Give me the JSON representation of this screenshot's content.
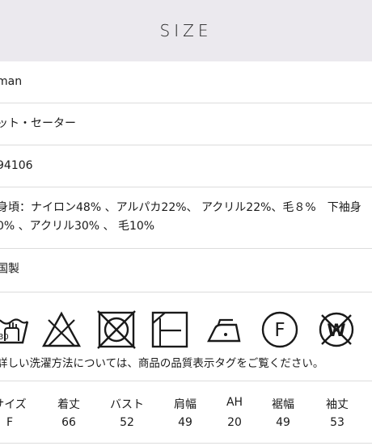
{
  "header": {
    "title": "SIZE"
  },
  "details": {
    "brand": "man",
    "category": "ット・セーター",
    "product_code": "94106",
    "material_line1": "身頃：ナイロン48% 、アルパカ22%、 アクリル22%、毛８%　下袖身",
    "material_line2": "0% 、アクリル30% 、 毛10%",
    "origin": "国製"
  },
  "care": {
    "icons": [
      "hand-wash-30-icon",
      "no-bleach-icon",
      "no-tumble-dry-icon",
      "line-dry-shade-icon",
      "iron-low-icon",
      "dry-clean-f-icon",
      "no-wet-clean-icon"
    ],
    "note": "詳しい洗濯方法については、商品の品質表示タグをご覧ください。"
  },
  "size_table": {
    "headers": [
      "サイズ",
      "着丈",
      "バスト",
      "肩幅",
      "AH",
      "裾幅",
      "袖丈"
    ],
    "values": [
      "F",
      "66",
      "52",
      "49",
      "20",
      "49",
      "53"
    ]
  }
}
